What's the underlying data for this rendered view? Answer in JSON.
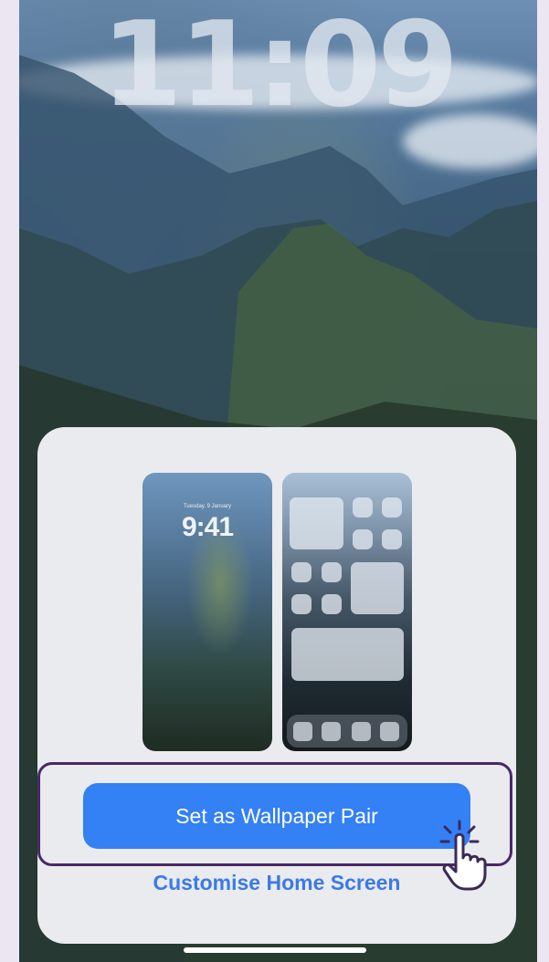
{
  "lock_screen": {
    "time": "11:09"
  },
  "sheet": {
    "lock_preview": {
      "date": "Tuesday, 9 January",
      "time": "9:41"
    },
    "primary_button": "Set as Wallpaper Pair",
    "secondary_link": "Customise Home Screen"
  },
  "colors": {
    "accent": "#3480f5",
    "highlight": "#4a2868",
    "link": "#3b7ae6"
  },
  "icons": [
    "pointer-hand-icon"
  ]
}
